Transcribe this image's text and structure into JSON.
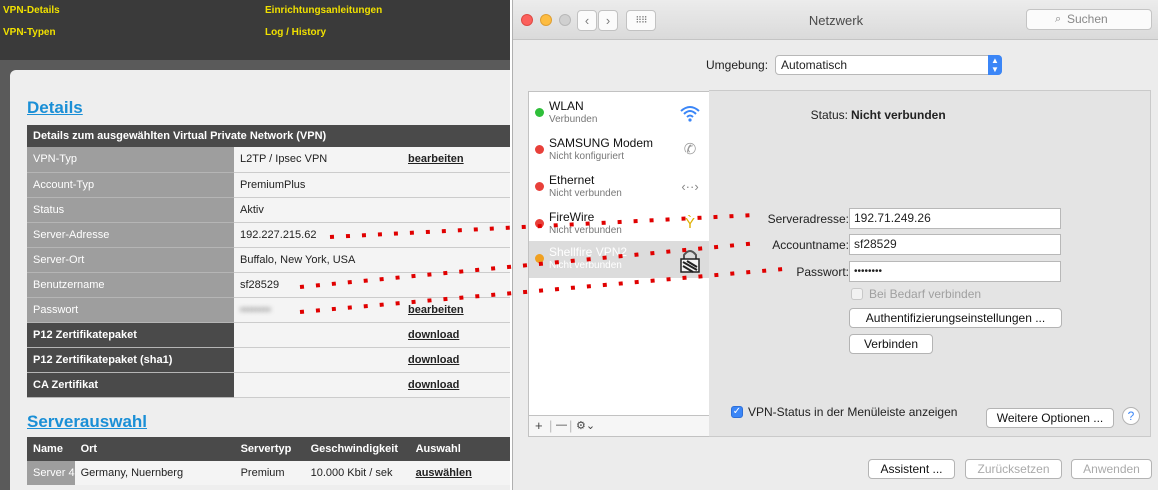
{
  "web": {
    "nav": [
      "VPN-Details",
      "Einrichtungsanleitungen",
      "VPN-Typen",
      "Log / History"
    ],
    "details_heading": "Details",
    "table_header": "Details zum ausgewählten Virtual Private Network (VPN)",
    "rows": [
      {
        "label": "VPN-Typ",
        "value": "L2TP / Ipsec VPN",
        "action": "bearbeiten"
      },
      {
        "label": "Account-Typ",
        "value": "PremiumPlus",
        "action": ""
      },
      {
        "label": "Status",
        "value": "Aktiv",
        "action": ""
      },
      {
        "label": "Server-Adresse",
        "value": "192.227.215.62",
        "action": ""
      },
      {
        "label": "Server-Ort",
        "value": "Buffalo, New York, USA",
        "action": ""
      },
      {
        "label": "Benutzername",
        "value": "sf28529",
        "action": ""
      },
      {
        "label": "Passwort",
        "value": "••••••••",
        "action": "bearbeiten"
      },
      {
        "label": "P12 Zertifikatepaket",
        "value": "",
        "action": "download"
      },
      {
        "label": "P12 Zertifikatepaket (sha1)",
        "value": "",
        "action": "download"
      },
      {
        "label": "CA Zertifikat",
        "value": "",
        "action": "download"
      }
    ],
    "server_heading": "Serverauswahl",
    "server_cols": [
      "Name",
      "Ort",
      "Servertyp",
      "Geschwindigkeit",
      "Auswahl"
    ],
    "server_row": [
      "Server 4",
      "Germany, Nuernberg",
      "Premium",
      "10.000 Kbit / sek",
      "auswählen"
    ]
  },
  "mac": {
    "title": "Netzwerk",
    "search_placeholder": "Suchen",
    "umgebung_label": "Umgebung:",
    "umgebung_value": "Automatisch",
    "services": [
      {
        "name": "WLAN",
        "status": "Verbunden",
        "dot": "#2fbf3a",
        "icon": "wifi-icon"
      },
      {
        "name": "SAMSUNG Modem",
        "status": "Nicht konfiguriert",
        "dot": "#e8403a",
        "icon": "phone-icon"
      },
      {
        "name": "Ethernet",
        "status": "Nicht verbunden",
        "dot": "#e8403a",
        "icon": "ethernet-icon"
      },
      {
        "name": "FireWire",
        "status": "Nicht verbunden",
        "dot": "#e8403a",
        "icon": "firewire-icon"
      },
      {
        "name": "Shellfire VPN2",
        "status": "Nicht verbunden",
        "dot": "#f0a020",
        "icon": "lock-icon"
      }
    ],
    "status_label": "Status:",
    "status_value": "Nicht verbunden",
    "server_label": "Serveradresse:",
    "server_value": "192.71.249.26",
    "account_label": "Accountname:",
    "account_value": "sf28529",
    "password_label": "Passwort:",
    "password_value": "••••••••",
    "on_demand": "Bei Bedarf verbinden",
    "auth_button": "Authentifizierungseinstellungen ...",
    "connect_button": "Verbinden",
    "show_status": "VPN-Status in der Menüleiste anzeigen",
    "more_options": "Weitere Optionen ...",
    "help": "?",
    "assistant": "Assistent ...",
    "reset": "Zurücksetzen",
    "apply": "Anwenden",
    "list_add": "+",
    "list_remove": "—",
    "list_gear": "⚙︎⌄"
  },
  "colors": {
    "link_blue": "#1a8fd6",
    "nav_yellow": "#f0e000",
    "mac_accent": "#3b86f7",
    "dots_red": "#e00000"
  }
}
